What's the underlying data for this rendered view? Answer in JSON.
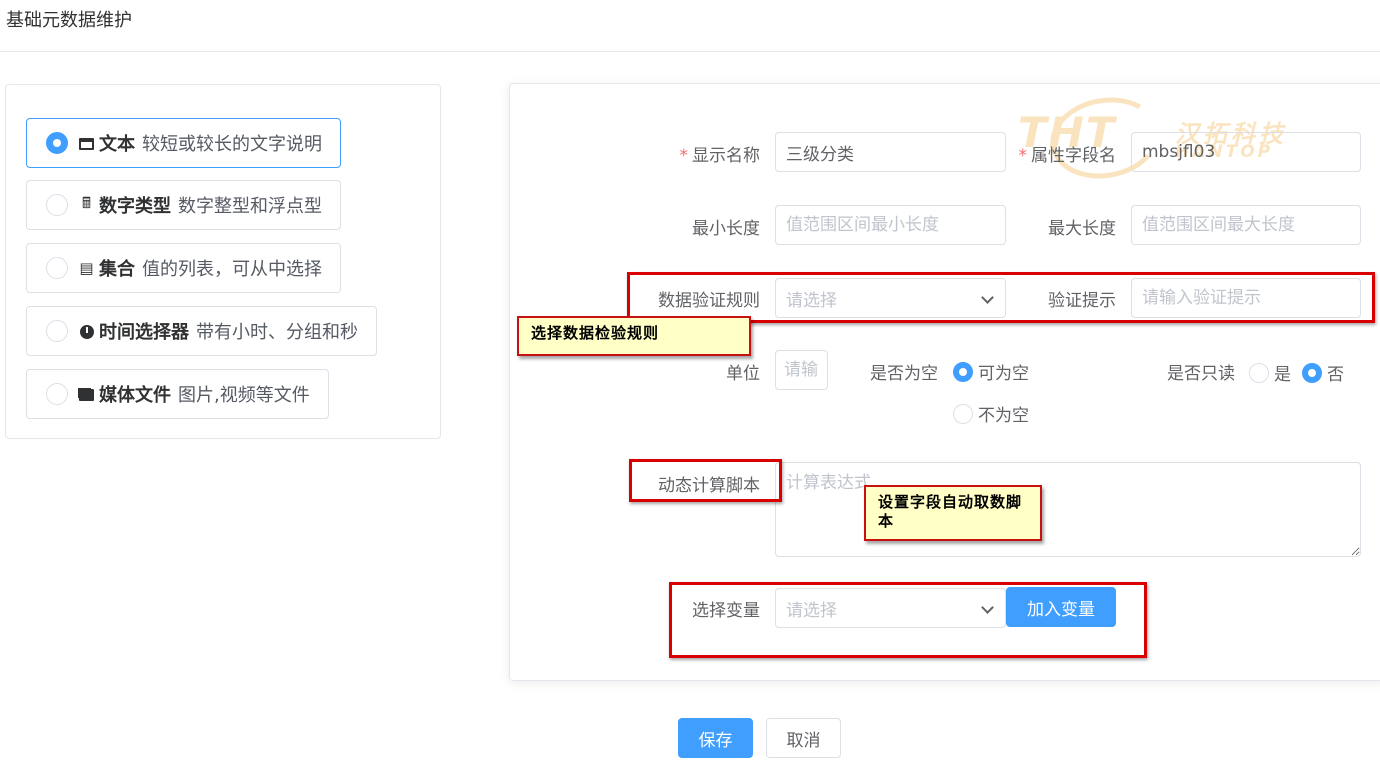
{
  "page": {
    "title": "基础元数据维护"
  },
  "types": [
    {
      "name": "文本",
      "desc": "较短或较长的文字说明",
      "icon": "window-icon",
      "checked": true
    },
    {
      "name": "数字类型",
      "desc": "数字整型和浮点型",
      "icon": "calculator-icon",
      "glyph": "🖩",
      "checked": false
    },
    {
      "name": "集合",
      "desc": "值的列表，可从中选择",
      "icon": "list-icon",
      "glyph": "▤",
      "checked": false
    },
    {
      "name": "时间选择器",
      "desc": "带有小时、分组和秒",
      "icon": "clock-icon",
      "checked": false
    },
    {
      "name": "媒体文件",
      "desc": "图片,视频等文件",
      "icon": "media-icon",
      "checked": false
    }
  ],
  "form": {
    "display_name": {
      "label": "显示名称",
      "value": "三级分类",
      "required": true
    },
    "field_name": {
      "label": "属性字段名",
      "value": "mbsjfl03",
      "required": true
    },
    "min_length": {
      "label": "最小长度",
      "placeholder": "值范围区间最小长度"
    },
    "max_length": {
      "label": "最大长度",
      "placeholder": "值范围区间最大长度"
    },
    "validation_rule": {
      "label": "数据验证规则",
      "placeholder": "请选择"
    },
    "validation_tip": {
      "label": "验证提示",
      "placeholder": "请输入验证提示"
    },
    "unit": {
      "label": "单位",
      "placeholder": "请输入"
    },
    "nullable": {
      "label": "是否为空",
      "options": [
        "可为空",
        "不为空"
      ],
      "selected": "可为空"
    },
    "readonly": {
      "label": "是否只读",
      "options": [
        "是",
        "否"
      ],
      "selected": "否"
    },
    "script": {
      "label": "动态计算脚本",
      "placeholder": "计算表达式"
    },
    "variable": {
      "label": "选择变量",
      "placeholder": "请选择",
      "add_button": "加入变量"
    }
  },
  "annotations": {
    "note_validation": "选择数据检验规则",
    "note_script": "设置字段自动取数脚本"
  },
  "actions": {
    "save": "保存",
    "cancel": "取消"
  },
  "watermark": {
    "logo": "THT",
    "cn": "汉拓科技",
    "en": "HANTOP"
  },
  "colors": {
    "primary": "#409eff",
    "required": "#f56c6c",
    "annotation_border": "#d90000",
    "note_bg": "#ffffc6"
  }
}
